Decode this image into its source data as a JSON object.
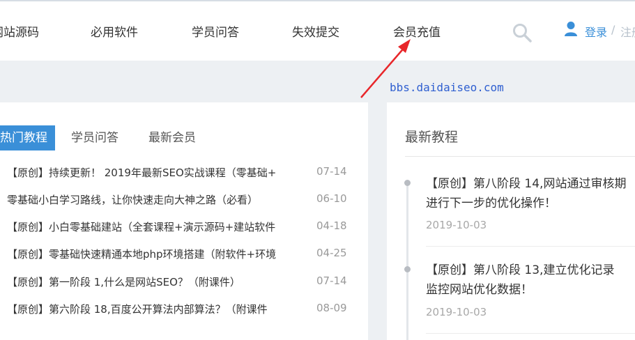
{
  "nav": {
    "items": [
      "网站源码",
      "必用软件",
      "学员问答",
      "失效提交",
      "会员充值"
    ],
    "login": "登录",
    "separator": "/",
    "register": "注册"
  },
  "watermark": "bbs.daidaiseo.com",
  "tabs": [
    "热门教程",
    "学员问答",
    "最新会员"
  ],
  "hot_list": [
    {
      "title": "【原创】持续更新！ 2019年最新SEO实战课程（零基础+",
      "date": "07-14"
    },
    {
      "title": "零基础小白学习路线，让你快速走向大神之路（必看）",
      "date": "06-10"
    },
    {
      "title": "【原创】小白零基础建站（全套课程+演示源码+建站软件",
      "date": "04-18"
    },
    {
      "title": "【原创】零基础快速精通本地php环境搭建（附软件+环境",
      "date": "04-25"
    },
    {
      "title": "【原创】第一阶段 1,什么是网站SEO？（附课件）",
      "date": "07-14"
    },
    {
      "title": "【原创】第六阶段 18,百度公开算法内部算法？（附课件",
      "date": "08-09"
    }
  ],
  "latest": {
    "title": "最新教程",
    "items": [
      {
        "line1": "【原创】第八阶段 14,网站通过审核期",
        "line2": "进行下一步的优化操作！",
        "date": "2019-10-03"
      },
      {
        "line1": "【原创】第八阶段 13,建立优化记录",
        "line2": "监控网站优化数据！",
        "date": "2019-10-03"
      }
    ]
  },
  "colors": {
    "accent": "#3a8fd8",
    "annotation_arrow": "#e8262a",
    "watermark": "#2f5fd0"
  },
  "icons": [
    "search-icon",
    "user-icon"
  ]
}
